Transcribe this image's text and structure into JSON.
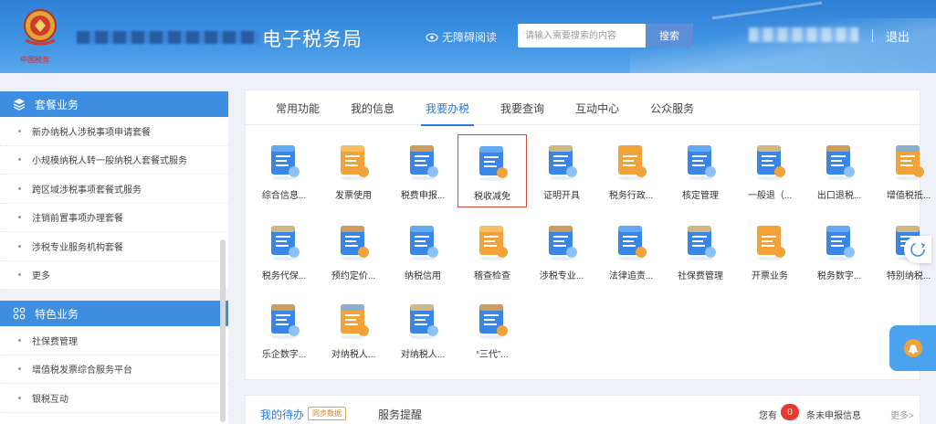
{
  "header": {
    "emblem_caption": "中国税务",
    "site_title": "电子税务局",
    "accessible_reading": "无障碍阅读",
    "search_placeholder": "请输入需要搜索的内容",
    "search_button": "搜索",
    "logout": "退出",
    "colors": {
      "header_blue": "#3f93e3",
      "accent": "#2c7ad6"
    }
  },
  "sidebar": {
    "section1_title": "套餐业务",
    "section1_items": [
      {
        "label": "新办纳税人涉税事项申请套餐"
      },
      {
        "label": "小规模纳税人转一般纳税人套餐式服务"
      },
      {
        "label": "跨区域涉税事项套餐式服务"
      },
      {
        "label": "注销前置事项办理套餐"
      },
      {
        "label": "涉税专业服务机构套餐"
      },
      {
        "label": "更多"
      }
    ],
    "section2_title": "特色业务",
    "section2_items": [
      {
        "label": "社保费管理"
      },
      {
        "label": "增值税发票综合服务平台"
      },
      {
        "label": "银税互动"
      }
    ]
  },
  "tabs": [
    {
      "label": "常用功能"
    },
    {
      "label": "我的信息"
    },
    {
      "label": "我要办税",
      "active": true
    },
    {
      "label": "我要查询"
    },
    {
      "label": "互动中心"
    },
    {
      "label": "公众服务"
    }
  ],
  "functions": [
    {
      "label": "综合信息...",
      "icon": "info-report-icon"
    },
    {
      "label": "发票使用",
      "icon": "invoice-icon"
    },
    {
      "label": "税费申报...",
      "icon": "tax-declare-icon"
    },
    {
      "label": "税收减免",
      "icon": "tax-reduction-icon",
      "selected": true
    },
    {
      "label": "证明开具",
      "icon": "certificate-icon"
    },
    {
      "label": "税务行政...",
      "icon": "tax-admin-icon"
    },
    {
      "label": "核定管理",
      "icon": "assessment-icon"
    },
    {
      "label": "一般退（...",
      "icon": "refund-icon"
    },
    {
      "label": "出口退税...",
      "icon": "export-refund-icon"
    },
    {
      "label": "增值税抵...",
      "icon": "vat-deduct-icon"
    },
    {
      "label": "税务代保...",
      "icon": "custody-icon"
    },
    {
      "label": "预约定价...",
      "icon": "advance-pricing-icon"
    },
    {
      "label": "纳税信用",
      "icon": "tax-credit-icon"
    },
    {
      "label": "稽查检查",
      "icon": "inspection-icon"
    },
    {
      "label": "涉税专业...",
      "icon": "professional-service-icon"
    },
    {
      "label": "法律追责...",
      "icon": "legal-icon"
    },
    {
      "label": "社保费管理",
      "icon": "social-security-icon"
    },
    {
      "label": "开票业务",
      "icon": "invoicing-icon"
    },
    {
      "label": "税务数字...",
      "icon": "digital-account-icon"
    },
    {
      "label": "特别纳税...",
      "icon": "special-tax-icon"
    },
    {
      "label": "乐企数字...",
      "icon": "leqi-icon"
    },
    {
      "label": "对纳税人...",
      "icon": "taxpayer-a-icon"
    },
    {
      "label": "对纳税人...",
      "icon": "taxpayer-b-icon"
    },
    {
      "label": "“三代”...",
      "icon": "three-agency-icon"
    }
  ],
  "bottom": {
    "my_todo": "我的待办",
    "sync_badge": "同步数据",
    "reminder": "服务提醒",
    "you_have": "您有",
    "count": "0",
    "pending_text": "条未申报信息",
    "more": "更多>"
  }
}
